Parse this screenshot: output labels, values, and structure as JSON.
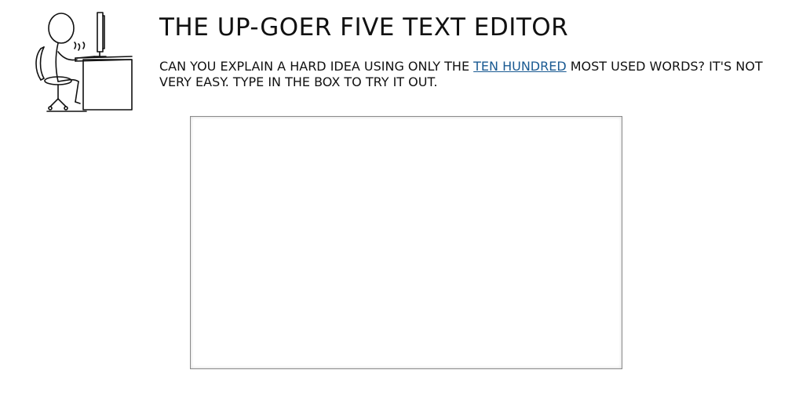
{
  "header": {
    "title": "THE UP-GOER FIVE TEXT EDITOR",
    "illustration_icon": "person-at-computer-desk-icon"
  },
  "intro": {
    "text_before_link": "CAN YOU EXPLAIN A HARD IDEA USING ONLY THE ",
    "link_label": "TEN HUNDRED",
    "text_after_link": " MOST USED WORDS? IT'S NOT VERY EASY. TYPE IN THE BOX TO TRY IT OUT."
  },
  "editor": {
    "value": "",
    "placeholder": ""
  },
  "colors": {
    "link": "#1a5a92",
    "text": "#111111",
    "editor_border": "#8a8a8a"
  }
}
